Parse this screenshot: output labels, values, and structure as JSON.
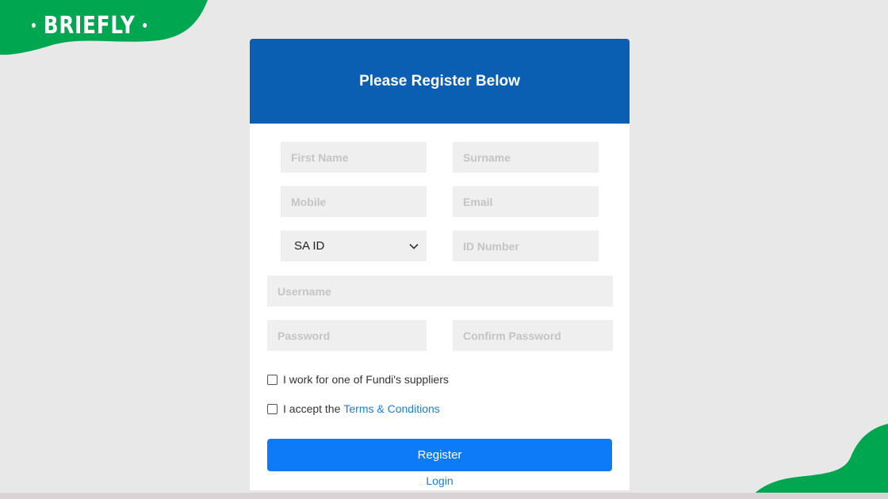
{
  "brand": {
    "logo_text": "BRIEFLY",
    "accent_color": "#00a650"
  },
  "form": {
    "title": "Please Register Below",
    "header_color": "#0b5fb3",
    "fields": {
      "first_name_placeholder": "First Name",
      "surname_placeholder": "Surname",
      "mobile_placeholder": "Mobile",
      "email_placeholder": "Email",
      "id_type_selected": "SA ID",
      "id_number_placeholder": "ID Number",
      "username_placeholder": "Username",
      "password_placeholder": "Password",
      "confirm_password_placeholder": "Confirm Password"
    },
    "checkboxes": {
      "supplier_label": "I work for one of Fundi's suppliers",
      "terms_prefix": "I accept the",
      "terms_link": "Terms & Conditions"
    },
    "register_label": "Register",
    "register_color": "#0d7bf7",
    "login_label": "Login"
  },
  "icons": {
    "select_arrow": "chevron-down-icon",
    "checkbox": "checkbox-icon"
  }
}
